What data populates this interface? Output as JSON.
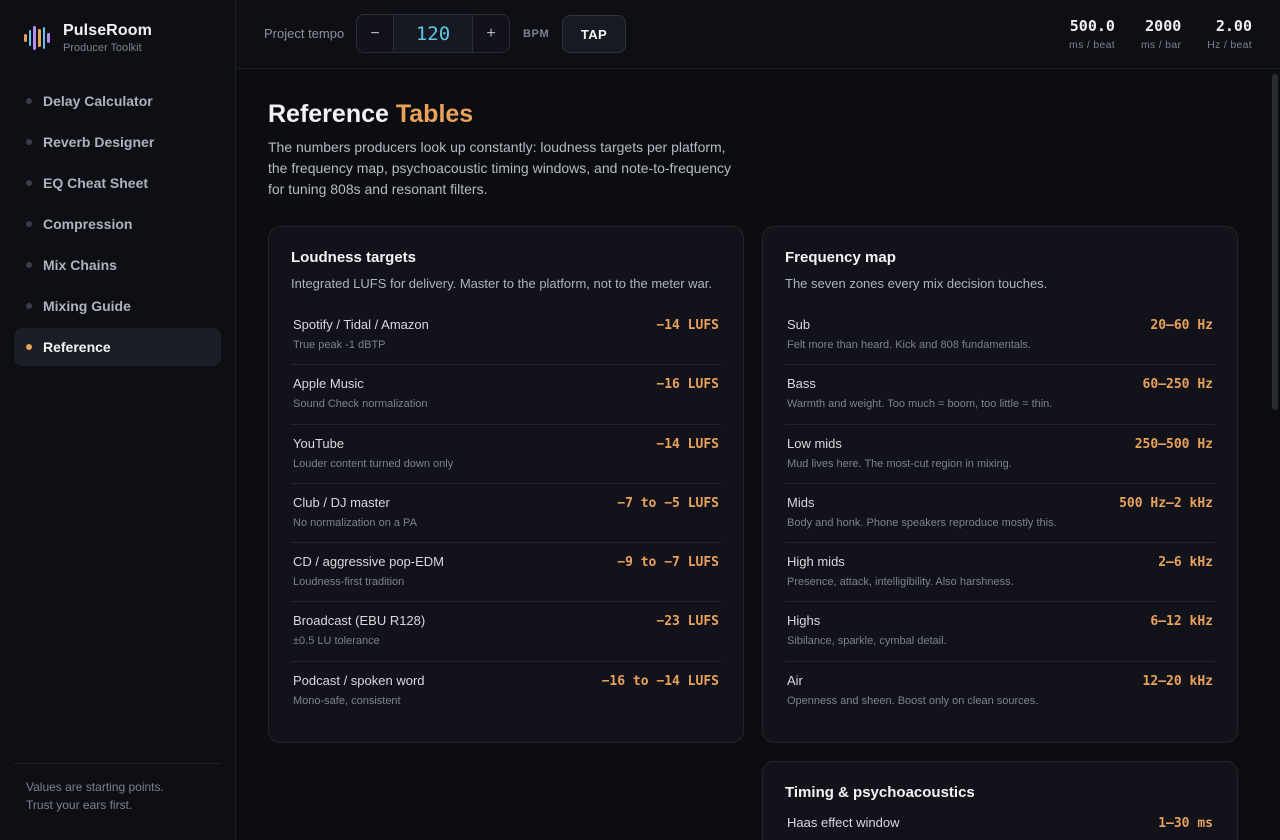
{
  "brand": {
    "name": "PulseRoom",
    "subtitle": "Producer Toolkit",
    "logo_colors": [
      "#e9a15c",
      "#5cc8e6",
      "#b58cf0",
      "#e9a15c",
      "#5cc8e6",
      "#b58cf0"
    ]
  },
  "nav": {
    "items": [
      {
        "label": "Delay Calculator"
      },
      {
        "label": "Reverb Designer"
      },
      {
        "label": "EQ Cheat Sheet"
      },
      {
        "label": "Compression"
      },
      {
        "label": "Mix Chains"
      },
      {
        "label": "Mixing Guide"
      },
      {
        "label": "Reference"
      }
    ],
    "active": "Reference"
  },
  "sidebar_footer": {
    "line1": "Values are starting points.",
    "line2": "Trust your ears first."
  },
  "topbar": {
    "tempo_label": "Project tempo",
    "decrement": "−",
    "increment": "+",
    "bpm_value": "120",
    "bpm_unit": "BPM",
    "tap_label": "TAP",
    "stats": [
      {
        "value": "500.0",
        "unit": "ms / beat"
      },
      {
        "value": "2000",
        "unit": "ms / bar"
      },
      {
        "value": "2.00",
        "unit": "Hz / beat"
      }
    ]
  },
  "page": {
    "title_main": "Reference ",
    "title_accent": "Tables",
    "description": "The numbers producers look up constantly: loudness targets per platform, the frequency map, psychoacoustic timing windows, and note-to-frequency for tuning 808s and resonant filters."
  },
  "loudness": {
    "title": "Loudness targets",
    "description": "Integrated LUFS for delivery. Master to the platform, not to the meter war.",
    "rows": [
      {
        "name": "Spotify / Tidal / Amazon",
        "sub": "True peak -1 dBTP",
        "value": "−14 LUFS"
      },
      {
        "name": "Apple Music",
        "sub": "Sound Check normalization",
        "value": "−16 LUFS"
      },
      {
        "name": "YouTube",
        "sub": "Louder content turned down only",
        "value": "−14 LUFS"
      },
      {
        "name": "Club / DJ master",
        "sub": "No normalization on a PA",
        "value": "−7 to −5 LUFS"
      },
      {
        "name": "CD / aggressive pop-EDM",
        "sub": "Loudness-first tradition",
        "value": "−9 to −7 LUFS"
      },
      {
        "name": "Broadcast (EBU R128)",
        "sub": "±0.5 LU tolerance",
        "value": "−23 LUFS"
      },
      {
        "name": "Podcast / spoken word",
        "sub": "Mono-safe, consistent",
        "value": "−16 to −14 LUFS"
      }
    ]
  },
  "frequency": {
    "title": "Frequency map",
    "description": "The seven zones every mix decision touches.",
    "rows": [
      {
        "name": "Sub",
        "sub": "Felt more than heard. Kick and 808 fundamentals.",
        "value": "20–60 Hz"
      },
      {
        "name": "Bass",
        "sub": "Warmth and weight. Too much = boom, too little = thin.",
        "value": "60–250 Hz"
      },
      {
        "name": "Low mids",
        "sub": "Mud lives here. The most-cut region in mixing.",
        "value": "250–500 Hz"
      },
      {
        "name": "Mids",
        "sub": "Body and honk. Phone speakers reproduce mostly this.",
        "value": "500 Hz–2 kHz"
      },
      {
        "name": "High mids",
        "sub": "Presence, attack, intelligibility. Also harshness.",
        "value": "2–6 kHz"
      },
      {
        "name": "Highs",
        "sub": "Sibilance, sparkle, cymbal detail.",
        "value": "6–12 kHz"
      },
      {
        "name": "Air",
        "sub": "Openness and sheen. Boost only on clean sources.",
        "value": "12–20 kHz"
      }
    ]
  },
  "timing": {
    "title": "Timing & psychoacoustics",
    "rows": [
      {
        "name": "Haas effect window",
        "value": "1–30 ms"
      }
    ]
  },
  "colors": {
    "accent": "#e9a15c",
    "bpm_value": "#5cc8e6",
    "background": "#0c0d11",
    "card": "#12131a"
  }
}
